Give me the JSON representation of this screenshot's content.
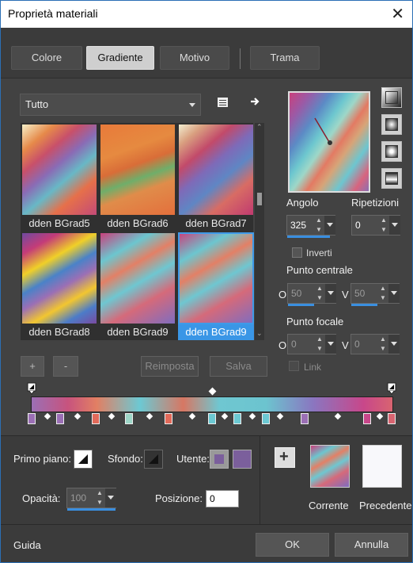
{
  "window": {
    "title": "Proprietà materiali",
    "close": "✕"
  },
  "tabs": [
    {
      "label": "Colore",
      "active": false
    },
    {
      "label": "Gradiente",
      "active": true
    },
    {
      "label": "Motivo",
      "active": false
    },
    {
      "label": "Trama",
      "active": false
    }
  ],
  "category": {
    "value": "Tutto"
  },
  "gradients": [
    {
      "name": "dden BGrad5"
    },
    {
      "name": "dden BGrad6"
    },
    {
      "name": "dden BGrad7"
    },
    {
      "name": "dden BGrad8"
    },
    {
      "name": "dden BGrad9"
    },
    {
      "name": "dden BGrad9",
      "selected": true
    }
  ],
  "buttons": {
    "add": "+",
    "remove": "-",
    "reset": "Reimposta",
    "save": "Salva"
  },
  "angle": {
    "label": "Angolo",
    "value": "325",
    "fill": 0.9
  },
  "repeats": {
    "label": "Ripetizioni",
    "value": "0"
  },
  "invert": {
    "label": "Inverti",
    "checked": false
  },
  "center": {
    "label": "Punto centrale",
    "o_label": "O",
    "v_label": "V",
    "o": "50",
    "v": "50"
  },
  "focal": {
    "label": "Punto focale",
    "o_label": "O",
    "v_label": "V",
    "o": "0",
    "v": "0"
  },
  "link": {
    "label": "Link",
    "checked": false
  },
  "bottom": {
    "foreground_label": "Primo piano:",
    "background_label": "Sfondo:",
    "user_label": "Utente:",
    "opacity_label": "Opacità:",
    "opacity": "100",
    "position_label": "Posizione:",
    "position": "0",
    "current_label": "Corrente",
    "previous_label": "Precedente"
  },
  "footer": {
    "help": "Guida",
    "ok": "OK",
    "cancel": "Annulla"
  },
  "colors": {
    "accent": "#3a96e6",
    "user_swatch": "#7b5f9c"
  }
}
